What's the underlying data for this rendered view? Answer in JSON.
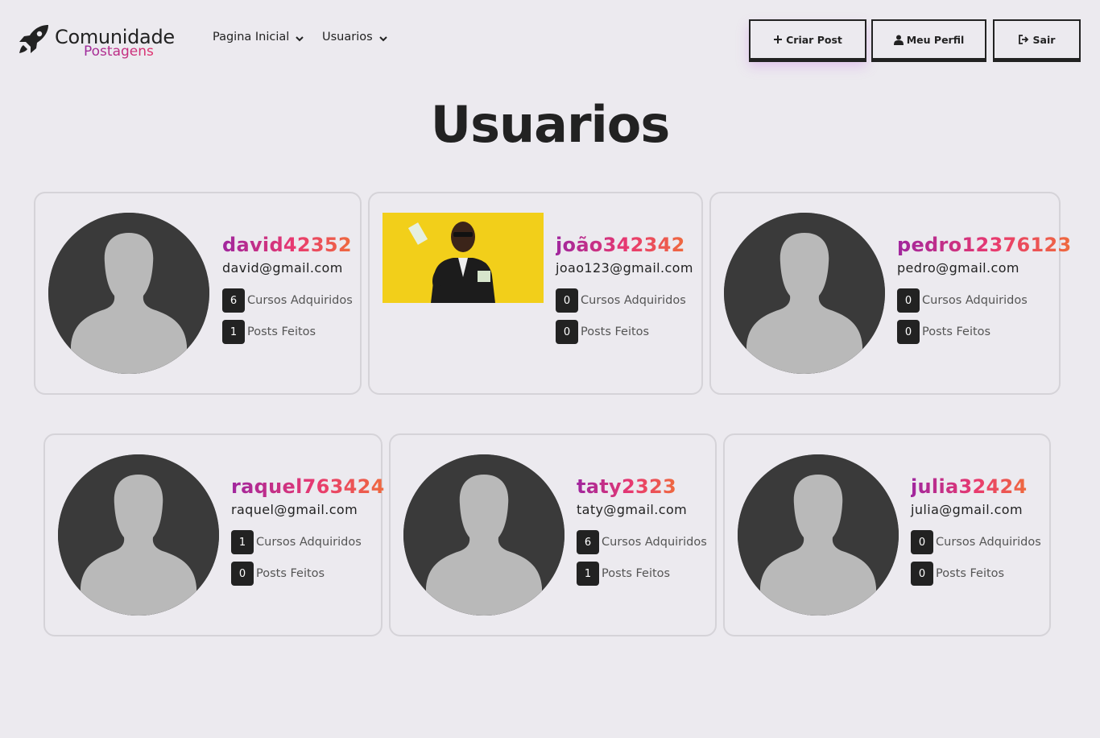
{
  "header": {
    "logo_title": "Comunidade",
    "logo_subtitle": "Postagens",
    "logo_icon": "rocket-icon",
    "nav": [
      {
        "label": "Pagina Inicial"
      },
      {
        "label": "Usuarios"
      }
    ],
    "buttons": {
      "create_post": "Criar Post",
      "my_profile": "Meu Perfil",
      "logout": "Sair"
    }
  },
  "page_title": "Usuarios",
  "stat_labels": {
    "courses": "Cursos Adquiridos",
    "posts": "Posts Feitos"
  },
  "users": [
    {
      "username": "david42352",
      "email": "david@gmail.com",
      "courses": "6",
      "posts": "1",
      "avatar": "default-avatar-icon"
    },
    {
      "username": "joão342342",
      "email": "joao123@gmail.com",
      "courses": "0",
      "posts": "0",
      "avatar": "profile-photo"
    },
    {
      "username": "pedro12376123",
      "email": "pedro@gmail.com",
      "courses": "0",
      "posts": "0",
      "avatar": "default-avatar-icon"
    },
    {
      "username": "raquel763424",
      "email": "raquel@gmail.com",
      "courses": "1",
      "posts": "0",
      "avatar": "default-avatar-icon"
    },
    {
      "username": "taty2323",
      "email": "taty@gmail.com",
      "courses": "6",
      "posts": "1",
      "avatar": "default-avatar-icon"
    },
    {
      "username": "julia32424",
      "email": "julia@gmail.com",
      "courses": "0",
      "posts": "0",
      "avatar": "default-avatar-icon"
    }
  ],
  "colors": {
    "background": "#ECEAEF",
    "text": "#222222",
    "username_gradient": [
      "#a0269e",
      "#e83970",
      "#ef6a3e"
    ],
    "badge": "#222222",
    "card_border": "#d5d3d8",
    "photo_background": "#f2cf1a"
  }
}
